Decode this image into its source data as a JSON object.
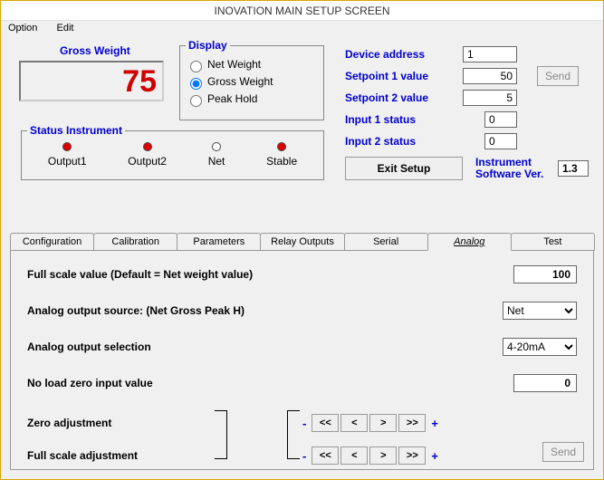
{
  "title": "INOVATION MAIN SETUP SCREEN",
  "menu": {
    "option": "Option",
    "edit": "Edit"
  },
  "gross_title": "Gross Weight",
  "weight_value": "75",
  "display": {
    "legend": "Display",
    "net": "Net Weight",
    "gross": "Gross Weight",
    "peak": "Peak Hold"
  },
  "status": {
    "legend": "Status Instrument",
    "out1": "Output1",
    "out2": "Output2",
    "net": "Net",
    "stable": "Stable"
  },
  "device": {
    "addr_l": "Device address",
    "addr_v": "1",
    "sp1_l": "Setpoint 1 value",
    "sp1_v": "50",
    "sp2_l": "Setpoint 2 value",
    "sp2_v": "5",
    "in1_l": "Input 1 status",
    "in1_v": "0",
    "in2_l": "Input 2 status",
    "in2_v": "0",
    "send": "Send"
  },
  "exit_label": "Exit Setup",
  "swver_label": "Instrument Software Ver.",
  "swver_value": "1.3",
  "tabs": {
    "config": "Configuration",
    "calib": "Calibration",
    "params": "Parameters",
    "relay": "Relay Outputs",
    "serial": "Serial",
    "analog": "Analog",
    "test": "Test"
  },
  "analog": {
    "fullscale_l": "Full scale value (Default = Net weight value)",
    "fullscale_v": "100",
    "src_l": "Analog output source: (Net Gross Peak H)",
    "src_v": "Net",
    "sel_l": "Analog output selection",
    "sel_v": "4-20mA",
    "noload_l": "No load zero input value",
    "noload_v": "0",
    "zero_l": "Zero adjustment",
    "full_l": "Full scale adjustment",
    "minus": "-",
    "plus": "+",
    "bbb": "<<",
    "bb": "<",
    "ff": ">",
    "fff": ">>",
    "send": "Send"
  }
}
